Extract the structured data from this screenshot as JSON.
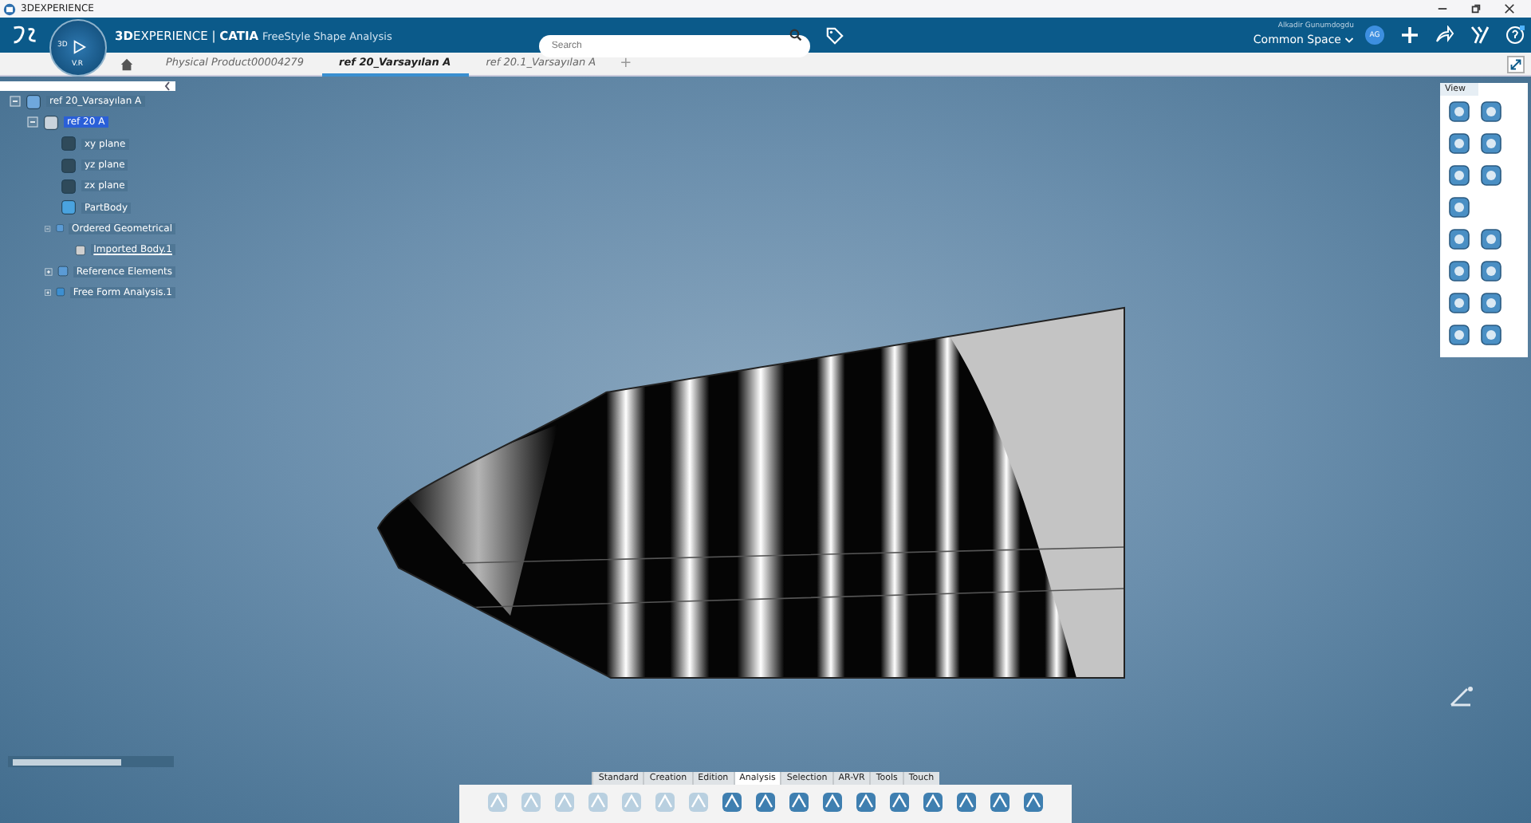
{
  "app_title": "3DEXPERIENCE",
  "header": {
    "brand_bold": "3D",
    "brand_rest": "EXPERIENCE",
    "separator": "|",
    "product": "CATIA",
    "app": "FreeStyle Shape Analysis",
    "search": {
      "placeholder": "Search"
    },
    "user": "Alkadir Gunumdogdu",
    "space": "Common Space",
    "avatar": "AG"
  },
  "compass": {
    "left": "3D",
    "bottom": "V.R"
  },
  "tabs": [
    {
      "label": "Physical Product00004279",
      "selected": false
    },
    {
      "label": "ref 20_Varsayılan A",
      "selected": true
    },
    {
      "label": "ref 20.1_Varsayılan A",
      "selected": false
    }
  ],
  "add_tab": "+",
  "tree": [
    {
      "label": "ref 20_Varsayılan A",
      "kind": "product",
      "expanded": true,
      "selected": false,
      "children": [
        {
          "label": "ref 20 A",
          "kind": "part",
          "expanded": true,
          "selected": true,
          "children": [
            {
              "label": "xy plane",
              "kind": "plane",
              "selected": false
            },
            {
              "label": "yz plane",
              "kind": "plane",
              "selected": false
            },
            {
              "label": "zx plane",
              "kind": "plane",
              "selected": false
            },
            {
              "label": "PartBody",
              "kind": "body",
              "selected": false
            },
            {
              "label": "Ordered Geometrical",
              "kind": "geoset",
              "expanded": true,
              "selected": false,
              "children": [
                {
                  "label": "Imported Body.1",
                  "kind": "import",
                  "selected": false
                }
              ]
            },
            {
              "label": "Reference Elements",
              "kind": "geoset",
              "expanded": false,
              "selected": false
            },
            {
              "label": "Free Form Analysis.1",
              "kind": "analysis",
              "expanded": false,
              "selected": false
            }
          ]
        }
      ]
    }
  ],
  "view_panel": {
    "title": "View"
  },
  "action_bar": {
    "tabs": [
      {
        "label": "Standard",
        "selected": false
      },
      {
        "label": "Creation",
        "selected": false
      },
      {
        "label": "Edition",
        "selected": false
      },
      {
        "label": "Analysis",
        "selected": true
      },
      {
        "label": "Selection",
        "selected": false
      },
      {
        "label": "AR-VR",
        "selected": false
      },
      {
        "label": "Tools",
        "selected": false
      },
      {
        "label": "Touch",
        "selected": false
      }
    ]
  }
}
